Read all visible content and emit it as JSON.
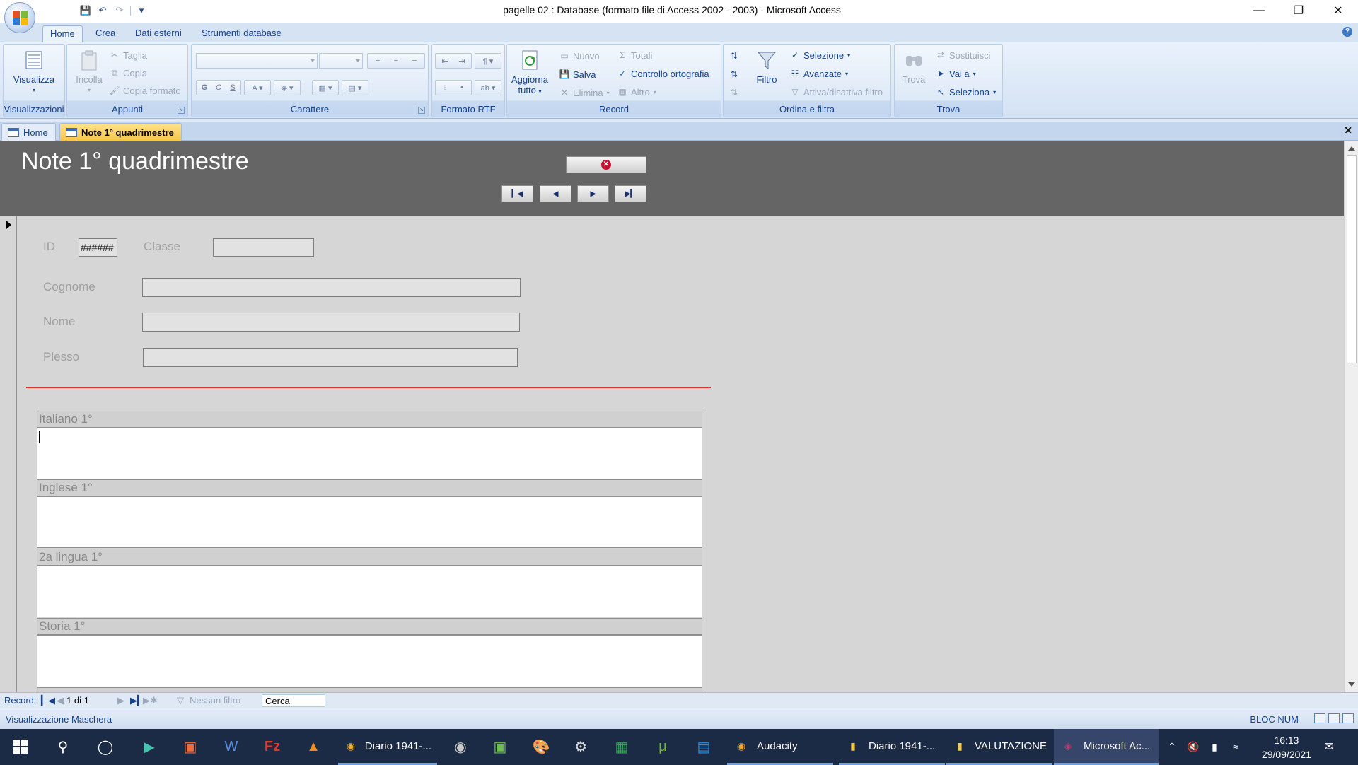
{
  "window": {
    "title": "pagelle 02 : Database (formato file di Access 2002 - 2003) - Microsoft Access",
    "minimize": "—",
    "restore": "❐",
    "close": "✕"
  },
  "ribbon_tabs": [
    "Home",
    "Crea",
    "Dati esterni",
    "Strumenti database"
  ],
  "ribbon": {
    "visualizzazioni": {
      "label": "Visualizzazioni",
      "visualizza": "Visualizza"
    },
    "appunti": {
      "label": "Appunti",
      "incolla": "Incolla",
      "taglia": "Taglia",
      "copia": "Copia",
      "copia_formato": "Copia formato"
    },
    "carattere": {
      "label": "Carattere",
      "bold": "G",
      "italic": "C",
      "underline": "S"
    },
    "formato_rtf": {
      "label": "Formato RTF"
    },
    "record": {
      "label": "Record",
      "aggiorna": "Aggiorna",
      "tutto": "tutto",
      "nuovo": "Nuovo",
      "salva": "Salva",
      "elimina": "Elimina",
      "totali": "Totali",
      "controllo": "Controllo ortografia",
      "altro": "Altro"
    },
    "ordina": {
      "label": "Ordina e filtra",
      "filtro": "Filtro",
      "selezione": "Selezione",
      "avanzate": "Avanzate",
      "attiva": "Attiva/disattiva filtro"
    },
    "trova": {
      "label": "Trova",
      "trova": "Trova",
      "sostituisci": "Sostituisci",
      "vai_a": "Vai a",
      "seleziona": "Seleziona"
    }
  },
  "doc_tabs": [
    "Home",
    "Note 1° quadrimestre"
  ],
  "form": {
    "title": "Note 1° quadrimestre",
    "fields": {
      "id_label": "ID",
      "id_value": "######",
      "classe_label": "Classe",
      "classe_value": "",
      "cognome_label": "Cognome",
      "cognome_value": "",
      "nome_label": "Nome",
      "nome_value": "",
      "plesso_label": "Plesso",
      "plesso_value": ""
    },
    "memos": [
      {
        "label": "Italiano 1°",
        "value": ""
      },
      {
        "label": "Inglese 1°",
        "value": ""
      },
      {
        "label": "2a lingua 1°",
        "value": ""
      },
      {
        "label": "Storia 1°",
        "value": ""
      }
    ]
  },
  "record_nav": {
    "label": "Record:",
    "position": "1 di 1",
    "filter": "Nessun filtro",
    "search": "Cerca"
  },
  "status": {
    "left": "Visualizzazione Maschera",
    "right": "BLOC NUM"
  },
  "taskbar": {
    "apps": [
      {
        "label": "Diario 1941-...",
        "icon": "chrome-icon"
      },
      {
        "label": "Audacity",
        "icon": "audacity-icon"
      },
      {
        "label": "Diario 1941-...",
        "icon": "folder-icon"
      },
      {
        "label": "VALUTAZIONE",
        "icon": "folder-icon"
      },
      {
        "label": "Microsoft Ac...",
        "icon": "access-icon"
      }
    ],
    "time": "16:13",
    "date": "29/09/2021"
  }
}
